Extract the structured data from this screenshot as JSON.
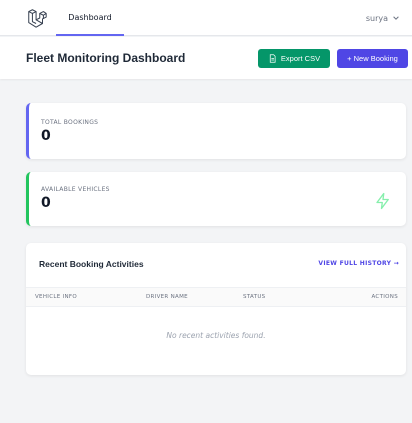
{
  "nav": {
    "logo_icon": "laravel-logo-icon",
    "dashboard_label": "Dashboard",
    "user_name": "surya",
    "user_menu_icon": "chevron-down-icon"
  },
  "header": {
    "title": "Fleet Monitoring Dashboard",
    "export_label": "Export CSV",
    "export_icon": "document-icon",
    "new_booking_label": "+ New Booking"
  },
  "stats": [
    {
      "label": "TOTAL BOOKINGS",
      "value": "0",
      "accent": "#6366f1"
    },
    {
      "label": "AVAILABLE VEHICLES",
      "value": "0",
      "accent": "#22c55e",
      "icon": "lightning-icon"
    }
  ],
  "activity": {
    "title": "Recent Booking Activities",
    "link_label": "VIEW FULL HISTORY →",
    "columns": [
      "VEHICLE INFO",
      "DRIVER NAME",
      "STATUS",
      "ACTIONS"
    ],
    "empty_message": "No recent activities found."
  },
  "colors": {
    "primary": "#4f46e5",
    "success": "#059669",
    "background": "#f3f4f6"
  }
}
